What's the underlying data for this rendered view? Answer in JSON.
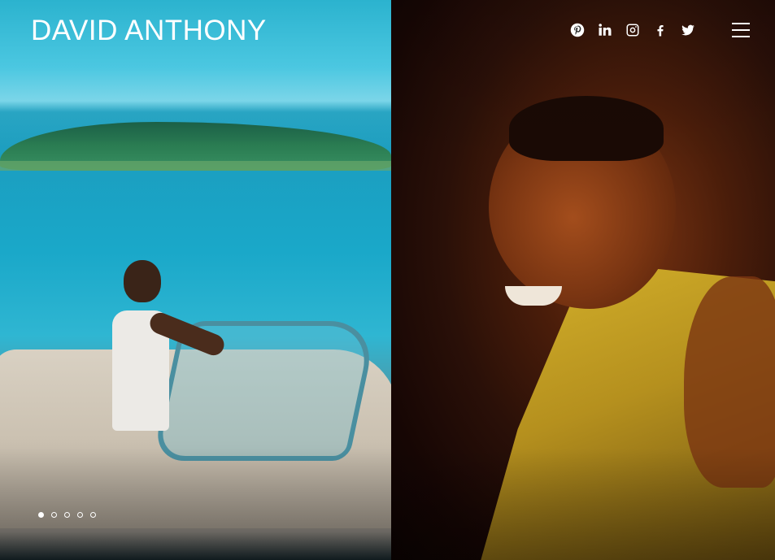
{
  "header": {
    "site_title": "DAVID ANTHONY"
  },
  "social_links": [
    {
      "icon": "pinterest-icon"
    },
    {
      "icon": "linkedin-icon"
    },
    {
      "icon": "instagram-icon"
    },
    {
      "icon": "facebook-icon"
    },
    {
      "icon": "twitter-icon"
    }
  ],
  "menu": {
    "icon": "hamburger-menu-icon"
  },
  "slider": {
    "total_slides": 5,
    "active_slide": 1
  },
  "colors": {
    "text": "#ffffff",
    "left_panel_accent": "#1aa8c9",
    "right_panel_accent": "#7a3412",
    "vest_accent": "#d5b22b"
  }
}
